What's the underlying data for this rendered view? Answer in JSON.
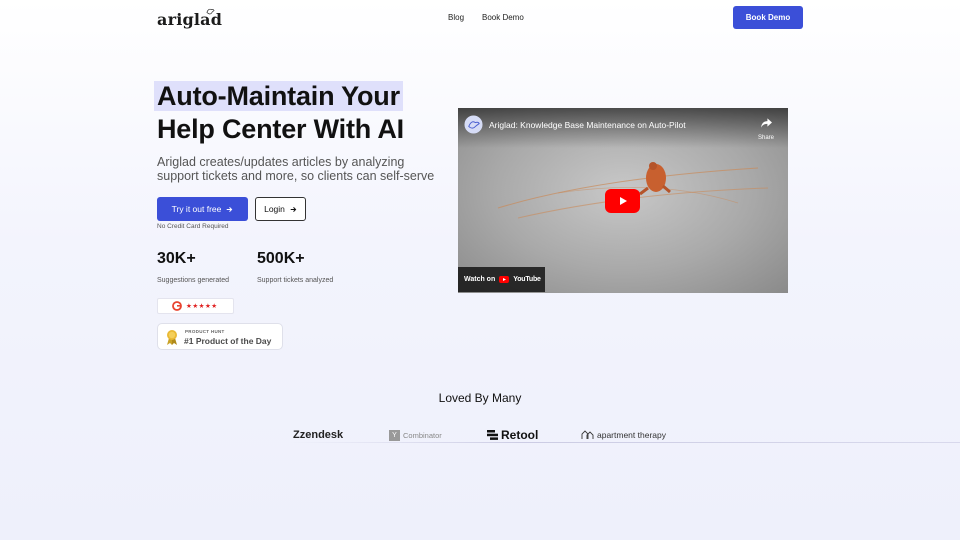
{
  "nav": {
    "logo_text": "ariglad",
    "links": [
      {
        "label": "Blog"
      },
      {
        "label": "Book Demo"
      }
    ],
    "cta_label": "Book Demo"
  },
  "hero": {
    "headline_line1": "Auto-Maintain Your",
    "headline_line2": "Help Center With AI",
    "subheading": "Ariglad creates/updates articles by analyzing support tickets and more, so clients can self-serve",
    "primary_button": "Try it out free",
    "secondary_button": "Login",
    "note": "No Credit Card Required",
    "stats": [
      {
        "value": "30K+",
        "label": "Suggestions generated"
      },
      {
        "value": "500K+",
        "label": "Support tickets analyzed"
      }
    ],
    "rating_stars": "★★★★★",
    "badge_kicker": "PRODUCT HUNT",
    "badge_title": "#1 Product of the Day"
  },
  "video": {
    "title": "Ariglad: Knowledge Base Maintenance on Auto-Pilot",
    "share_label": "Share",
    "watch_label": "Watch on",
    "youtube_word": "YouTube"
  },
  "social_proof": {
    "heading": "Loved By Many",
    "brands": [
      {
        "name": "zendesk",
        "mark": "Z"
      },
      {
        "name": "Combinator",
        "mark": "Y"
      },
      {
        "name": "Retool"
      },
      {
        "name": "apartment therapy"
      }
    ]
  },
  "colors": {
    "accent": "#3b4fd8",
    "highlight": "#dfe0fb",
    "play_button": "#ff0000"
  }
}
